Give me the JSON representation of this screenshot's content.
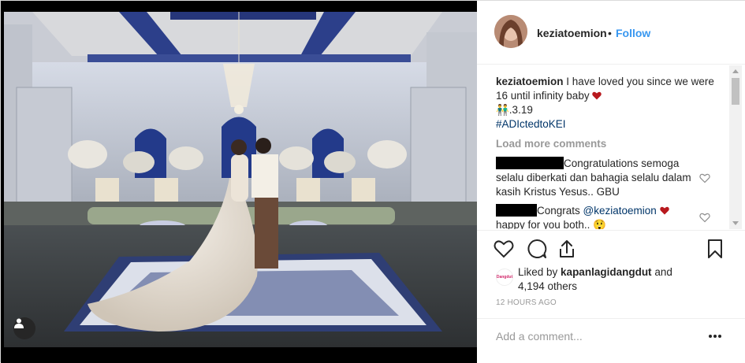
{
  "header": {
    "username": "keziatoemion",
    "dot": "•",
    "follow_label": "Follow"
  },
  "caption": {
    "username": "keziatoemion",
    "text": "I have loved you since we were 16 until infinity baby",
    "date": "👬.3.19",
    "hashtag": "#ADIctedtoKEI"
  },
  "load_more_label": "Load more comments",
  "comments": [
    {
      "text": "Congratulations semoga selalu diberkati dan bahagia selalu dalam kasih Kristus Yesus.. GBU"
    },
    {
      "text_before": "Congrats ",
      "mention": "@keziatoemion",
      "text_after": "happy for you both.. 😲"
    }
  ],
  "likes": {
    "avatar_label": "Dangdut",
    "prefix": "Liked by ",
    "username": "kapanlagidangdut",
    "suffix": " and",
    "others": "4,194 others"
  },
  "timestamp": "12 HOURS AGO",
  "add_comment_placeholder": "Add a comment...",
  "colors": {
    "link_blue": "#3897f0",
    "hashtag_blue": "#003569",
    "heart_red": "#ed4956"
  }
}
